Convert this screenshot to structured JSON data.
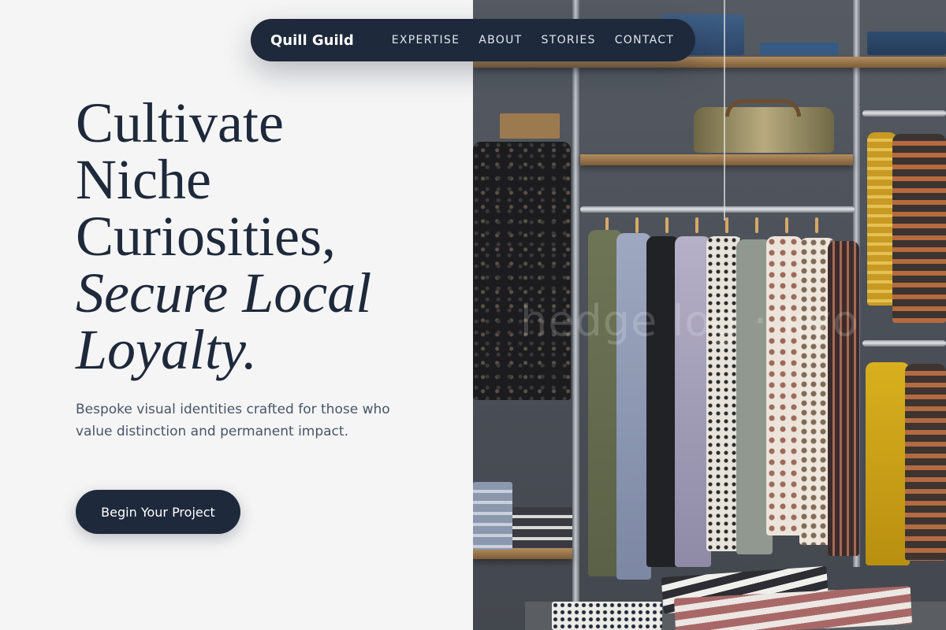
{
  "nav": {
    "brand": "Quill Guild",
    "links": [
      "EXPERTISE",
      "ABOUT",
      "STORIES",
      "CONTACT"
    ]
  },
  "hero": {
    "headline_lines": [
      "Cultivate",
      "Niche",
      "Curiosities,"
    ],
    "headline_italic_lines": [
      "Secure Local",
      "Loyalty."
    ],
    "subtitle": "Bespoke visual identities crafted for those who value distinction and permanent impact.",
    "cta_label": "Begin Your Project"
  },
  "image": {
    "watermark": "hedge log · kyo"
  },
  "colors": {
    "primary": "#1e293b",
    "text_muted": "#475569",
    "background": "#f5f5f5"
  }
}
